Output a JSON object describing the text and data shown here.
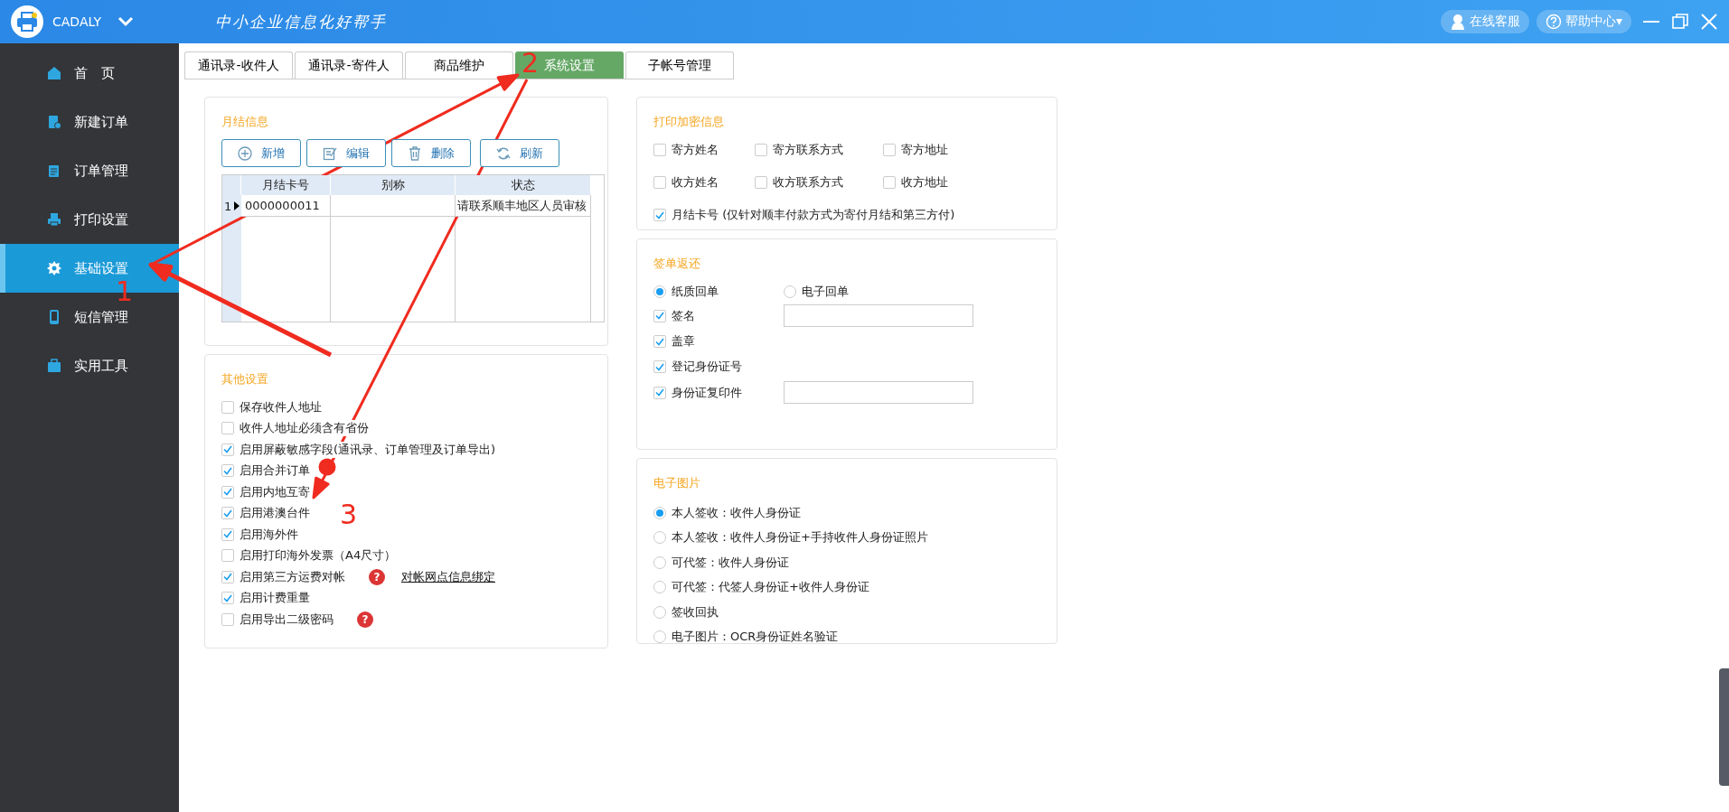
{
  "app": {
    "name": "CADALY",
    "slogan": "中小企业信息化好帮手"
  },
  "header_buttons": [
    {
      "kind": "service",
      "label": "在线客服"
    },
    {
      "kind": "help",
      "label": "帮助中心",
      "caret": "▾"
    }
  ],
  "sidebar": {
    "items": [
      {
        "label": "首　页",
        "selected": false
      },
      {
        "label": "新建订单",
        "selected": false
      },
      {
        "label": "订单管理",
        "selected": false
      },
      {
        "label": "打印设置",
        "selected": false
      },
      {
        "label": "基础设置",
        "selected": true
      },
      {
        "label": "短信管理",
        "selected": false
      },
      {
        "label": "实用工具",
        "selected": false
      }
    ]
  },
  "tabs": [
    {
      "label": "通讯录-收件人",
      "selected": false
    },
    {
      "label": "通讯录-寄件人",
      "selected": false
    },
    {
      "label": "商品维护",
      "selected": false
    },
    {
      "label": "系统设置",
      "selected": true
    },
    {
      "label": "子帐号管理",
      "selected": false
    }
  ],
  "monthly": {
    "title": "月结信息",
    "buttons": [
      {
        "kind": "add",
        "label": "新增"
      },
      {
        "kind": "edit",
        "label": "编辑"
      },
      {
        "kind": "delete",
        "label": "删除"
      },
      {
        "kind": "refresh",
        "label": "刷新"
      }
    ],
    "table": {
      "columns": [
        "月结卡号",
        "别称",
        "状态"
      ],
      "rows": [
        {
          "index": "1",
          "selected": true,
          "card": "0000000011",
          "status": "请联系顺丰地区人员审核"
        }
      ]
    }
  },
  "other": {
    "title": "其他设置",
    "items": [
      {
        "label": "保存收件人地址",
        "checked": false
      },
      {
        "label": "收件人地址必须含有省份",
        "checked": false
      },
      {
        "label": "启用屏蔽敏感字段(通讯录、订单管理及订单导出)",
        "checked": true
      },
      {
        "label": "启用合并订单",
        "checked": true
      },
      {
        "label": "启用内地互寄",
        "checked": true
      },
      {
        "label": "启用港澳台件",
        "checked": true
      },
      {
        "label": "启用海外件",
        "checked": true
      },
      {
        "label": "启用打印海外发票（A4尺寸）",
        "checked": false
      },
      {
        "label": "启用第三方运费对帐",
        "checked": true,
        "help": "?",
        "link": "对帐网点信息绑定"
      },
      {
        "label": "启用计费重量",
        "checked": true
      },
      {
        "label": "启用导出二级密码",
        "checked": false,
        "help": "?"
      }
    ]
  },
  "encryption": {
    "title": "打印加密信息",
    "items": [
      {
        "label": "寄方姓名",
        "checked": false
      },
      {
        "label": "寄方联系方式",
        "checked": false
      },
      {
        "label": "寄方地址",
        "checked": false
      },
      {
        "label": "收方姓名",
        "checked": false
      },
      {
        "label": "收方联系方式",
        "checked": false
      },
      {
        "label": "收方地址",
        "checked": false
      },
      {
        "label": "月结卡号 (仅针对顺丰付款方式为寄付月结和第三方付)",
        "checked": true
      }
    ]
  },
  "receipt": {
    "title": "签单返还",
    "radios": [
      {
        "label": "纸质回单",
        "selected": true
      },
      {
        "label": "电子回单",
        "selected": false
      }
    ],
    "items": [
      {
        "label": "签名",
        "checked": true,
        "field": true
      },
      {
        "label": "盖章",
        "checked": true
      },
      {
        "label": "登记身份证号",
        "checked": true
      },
      {
        "label": "身份证复印件",
        "checked": true,
        "field": true
      }
    ]
  },
  "photo": {
    "title": "电子图片",
    "radios": [
      {
        "label": "本人签收：收件人身份证",
        "selected": true
      },
      {
        "label": "本人签收：收件人身份证+手持收件人身份证照片",
        "selected": false
      },
      {
        "label": "可代签：收件人身份证",
        "selected": false
      },
      {
        "label": "可代签：代签人身份证+收件人身份证",
        "selected": false
      },
      {
        "label": "签收回执",
        "selected": false
      },
      {
        "label": "电子图片：OCR身份证姓名验证",
        "selected": false
      }
    ]
  },
  "annotations": [
    {
      "label": "1"
    },
    {
      "label": "2"
    },
    {
      "label": "3"
    }
  ]
}
